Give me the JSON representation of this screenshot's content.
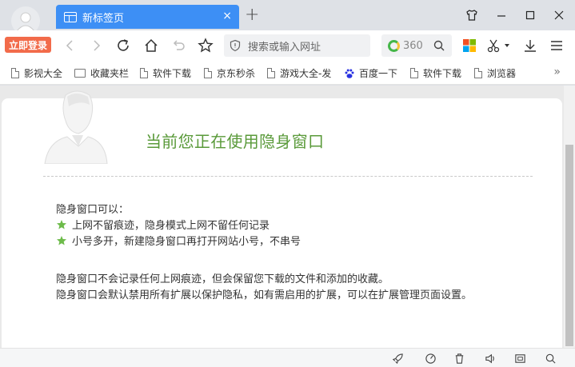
{
  "titlebar": {
    "tab_title": "新标签页",
    "tab_close": "×",
    "new_tab": "+"
  },
  "toolbar": {
    "login_label": "立即登录",
    "url_placeholder": "搜索或输入网址",
    "search_engine_label": "360"
  },
  "bookmarks": [
    {
      "label": "影视大全",
      "icon": "file-icon"
    },
    {
      "label": "收藏夹栏",
      "icon": "folder-icon"
    },
    {
      "label": "软件下载",
      "icon": "file-icon"
    },
    {
      "label": "京东秒杀",
      "icon": "file-icon"
    },
    {
      "label": "游戏大全-发",
      "icon": "file-icon"
    },
    {
      "label": "百度一下",
      "icon": "baidu-paw-icon"
    },
    {
      "label": "软件下载",
      "icon": "file-icon"
    },
    {
      "label": "浏览器",
      "icon": "file-icon"
    }
  ],
  "bookmarks_more": "»",
  "content": {
    "heading": "当前您正在使用隐身窗口",
    "intro": "隐身窗口可以：",
    "bullets": [
      "上网不留痕迹，隐身模式上网不留任何记录",
      "小号多开，新建隐身窗口再打开网站小号，不串号"
    ],
    "notes": [
      "隐身窗口不会记录任何上网痕迹，但会保留您下载的文件和添加的收藏。",
      "隐身窗口会默认禁用所有扩展以保护隐私，如有需启用的扩展，可以在扩展管理页面设置。"
    ]
  },
  "colors": {
    "tab_active": "#3d8ff5",
    "login_button": "#f26b4a",
    "heading_green": "#5a9a3a",
    "star_green": "#6dbb4a"
  }
}
